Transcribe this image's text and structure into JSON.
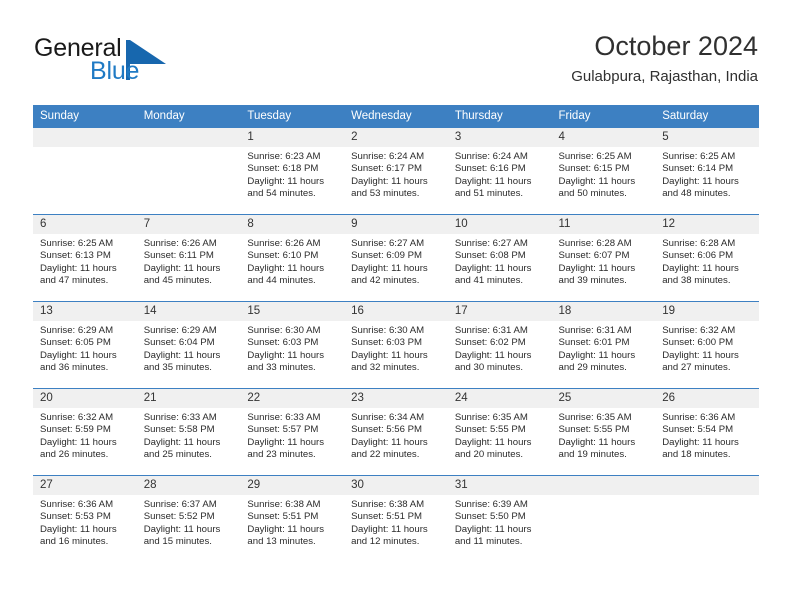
{
  "logo": {
    "word1": "General",
    "word2": "Blue",
    "icon": "triangle-logo-mark",
    "brand_color": "#1767ae",
    "accent_color": "#1f7ac4"
  },
  "header": {
    "month_title": "October 2024",
    "location": "Gulabpura, Rajasthan, India"
  },
  "calendar": {
    "header_bg": "#3d80c2",
    "daynum_bg": "#f0f0f0",
    "weekday_headers": [
      "Sunday",
      "Monday",
      "Tuesday",
      "Wednesday",
      "Thursday",
      "Friday",
      "Saturday"
    ],
    "weeks": [
      [
        {
          "day": "",
          "blank": true
        },
        {
          "day": "",
          "blank": true
        },
        {
          "day": "1",
          "sunrise": "Sunrise: 6:23 AM",
          "sunset": "Sunset: 6:18 PM",
          "daylight": "Daylight: 11 hours and 54 minutes."
        },
        {
          "day": "2",
          "sunrise": "Sunrise: 6:24 AM",
          "sunset": "Sunset: 6:17 PM",
          "daylight": "Daylight: 11 hours and 53 minutes."
        },
        {
          "day": "3",
          "sunrise": "Sunrise: 6:24 AM",
          "sunset": "Sunset: 6:16 PM",
          "daylight": "Daylight: 11 hours and 51 minutes."
        },
        {
          "day": "4",
          "sunrise": "Sunrise: 6:25 AM",
          "sunset": "Sunset: 6:15 PM",
          "daylight": "Daylight: 11 hours and 50 minutes."
        },
        {
          "day": "5",
          "sunrise": "Sunrise: 6:25 AM",
          "sunset": "Sunset: 6:14 PM",
          "daylight": "Daylight: 11 hours and 48 minutes."
        }
      ],
      [
        {
          "day": "6",
          "sunrise": "Sunrise: 6:25 AM",
          "sunset": "Sunset: 6:13 PM",
          "daylight": "Daylight: 11 hours and 47 minutes."
        },
        {
          "day": "7",
          "sunrise": "Sunrise: 6:26 AM",
          "sunset": "Sunset: 6:11 PM",
          "daylight": "Daylight: 11 hours and 45 minutes."
        },
        {
          "day": "8",
          "sunrise": "Sunrise: 6:26 AM",
          "sunset": "Sunset: 6:10 PM",
          "daylight": "Daylight: 11 hours and 44 minutes."
        },
        {
          "day": "9",
          "sunrise": "Sunrise: 6:27 AM",
          "sunset": "Sunset: 6:09 PM",
          "daylight": "Daylight: 11 hours and 42 minutes."
        },
        {
          "day": "10",
          "sunrise": "Sunrise: 6:27 AM",
          "sunset": "Sunset: 6:08 PM",
          "daylight": "Daylight: 11 hours and 41 minutes."
        },
        {
          "day": "11",
          "sunrise": "Sunrise: 6:28 AM",
          "sunset": "Sunset: 6:07 PM",
          "daylight": "Daylight: 11 hours and 39 minutes."
        },
        {
          "day": "12",
          "sunrise": "Sunrise: 6:28 AM",
          "sunset": "Sunset: 6:06 PM",
          "daylight": "Daylight: 11 hours and 38 minutes."
        }
      ],
      [
        {
          "day": "13",
          "sunrise": "Sunrise: 6:29 AM",
          "sunset": "Sunset: 6:05 PM",
          "daylight": "Daylight: 11 hours and 36 minutes."
        },
        {
          "day": "14",
          "sunrise": "Sunrise: 6:29 AM",
          "sunset": "Sunset: 6:04 PM",
          "daylight": "Daylight: 11 hours and 35 minutes."
        },
        {
          "day": "15",
          "sunrise": "Sunrise: 6:30 AM",
          "sunset": "Sunset: 6:03 PM",
          "daylight": "Daylight: 11 hours and 33 minutes."
        },
        {
          "day": "16",
          "sunrise": "Sunrise: 6:30 AM",
          "sunset": "Sunset: 6:03 PM",
          "daylight": "Daylight: 11 hours and 32 minutes."
        },
        {
          "day": "17",
          "sunrise": "Sunrise: 6:31 AM",
          "sunset": "Sunset: 6:02 PM",
          "daylight": "Daylight: 11 hours and 30 minutes."
        },
        {
          "day": "18",
          "sunrise": "Sunrise: 6:31 AM",
          "sunset": "Sunset: 6:01 PM",
          "daylight": "Daylight: 11 hours and 29 minutes."
        },
        {
          "day": "19",
          "sunrise": "Sunrise: 6:32 AM",
          "sunset": "Sunset: 6:00 PM",
          "daylight": "Daylight: 11 hours and 27 minutes."
        }
      ],
      [
        {
          "day": "20",
          "sunrise": "Sunrise: 6:32 AM",
          "sunset": "Sunset: 5:59 PM",
          "daylight": "Daylight: 11 hours and 26 minutes."
        },
        {
          "day": "21",
          "sunrise": "Sunrise: 6:33 AM",
          "sunset": "Sunset: 5:58 PM",
          "daylight": "Daylight: 11 hours and 25 minutes."
        },
        {
          "day": "22",
          "sunrise": "Sunrise: 6:33 AM",
          "sunset": "Sunset: 5:57 PM",
          "daylight": "Daylight: 11 hours and 23 minutes."
        },
        {
          "day": "23",
          "sunrise": "Sunrise: 6:34 AM",
          "sunset": "Sunset: 5:56 PM",
          "daylight": "Daylight: 11 hours and 22 minutes."
        },
        {
          "day": "24",
          "sunrise": "Sunrise: 6:35 AM",
          "sunset": "Sunset: 5:55 PM",
          "daylight": "Daylight: 11 hours and 20 minutes."
        },
        {
          "day": "25",
          "sunrise": "Sunrise: 6:35 AM",
          "sunset": "Sunset: 5:55 PM",
          "daylight": "Daylight: 11 hours and 19 minutes."
        },
        {
          "day": "26",
          "sunrise": "Sunrise: 6:36 AM",
          "sunset": "Sunset: 5:54 PM",
          "daylight": "Daylight: 11 hours and 18 minutes."
        }
      ],
      [
        {
          "day": "27",
          "sunrise": "Sunrise: 6:36 AM",
          "sunset": "Sunset: 5:53 PM",
          "daylight": "Daylight: 11 hours and 16 minutes."
        },
        {
          "day": "28",
          "sunrise": "Sunrise: 6:37 AM",
          "sunset": "Sunset: 5:52 PM",
          "daylight": "Daylight: 11 hours and 15 minutes."
        },
        {
          "day": "29",
          "sunrise": "Sunrise: 6:38 AM",
          "sunset": "Sunset: 5:51 PM",
          "daylight": "Daylight: 11 hours and 13 minutes."
        },
        {
          "day": "30",
          "sunrise": "Sunrise: 6:38 AM",
          "sunset": "Sunset: 5:51 PM",
          "daylight": "Daylight: 11 hours and 12 minutes."
        },
        {
          "day": "31",
          "sunrise": "Sunrise: 6:39 AM",
          "sunset": "Sunset: 5:50 PM",
          "daylight": "Daylight: 11 hours and 11 minutes."
        },
        {
          "day": "",
          "blank": true
        },
        {
          "day": "",
          "blank": true
        }
      ]
    ]
  }
}
